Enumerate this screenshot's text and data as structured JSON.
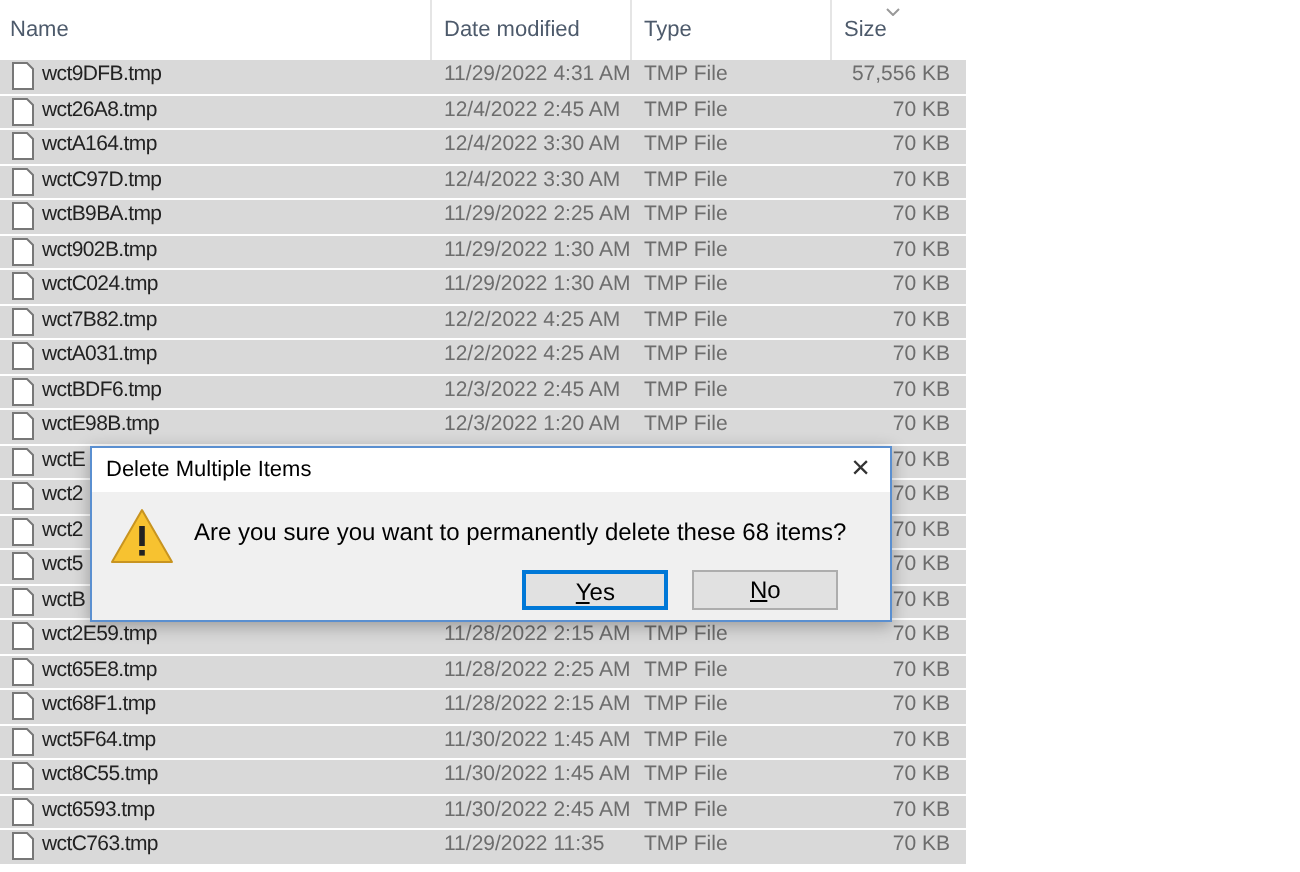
{
  "columns": [
    {
      "label": "Name"
    },
    {
      "label": "Date modified"
    },
    {
      "label": "Type"
    },
    {
      "label": "Size",
      "sorted": true
    }
  ],
  "rows": [
    {
      "name": "wct9DFB.tmp",
      "date": "11/29/2022 4:31 AM",
      "type": "TMP File",
      "size": "57,556 KB",
      "selected": true
    },
    {
      "name": "wct26A8.tmp",
      "date": "12/4/2022 2:45 AM",
      "type": "TMP File",
      "size": "70 KB",
      "selected": true
    },
    {
      "name": "wctA164.tmp",
      "date": "12/4/2022 3:30 AM",
      "type": "TMP File",
      "size": "70 KB",
      "selected": true
    },
    {
      "name": "wctC97D.tmp",
      "date": "12/4/2022 3:30 AM",
      "type": "TMP File",
      "size": "70 KB",
      "selected": true
    },
    {
      "name": "wctB9BA.tmp",
      "date": "11/29/2022 2:25 AM",
      "type": "TMP File",
      "size": "70 KB",
      "selected": true
    },
    {
      "name": "wct902B.tmp",
      "date": "11/29/2022 1:30 AM",
      "type": "TMP File",
      "size": "70 KB",
      "selected": true
    },
    {
      "name": "wctC024.tmp",
      "date": "11/29/2022 1:30 AM",
      "type": "TMP File",
      "size": "70 KB",
      "selected": true
    },
    {
      "name": "wct7B82.tmp",
      "date": "12/2/2022 4:25 AM",
      "type": "TMP File",
      "size": "70 KB",
      "selected": true
    },
    {
      "name": "wctA031.tmp",
      "date": "12/2/2022 4:25 AM",
      "type": "TMP File",
      "size": "70 KB",
      "selected": true
    },
    {
      "name": "wctBDF6.tmp",
      "date": "12/3/2022 2:45 AM",
      "type": "TMP File",
      "size": "70 KB",
      "selected": true
    },
    {
      "name": "wctE98B.tmp",
      "date": "12/3/2022 1:20 AM",
      "type": "TMP File",
      "size": "70 KB",
      "selected": true
    },
    {
      "name": "wctE",
      "size": "70 KB",
      "selected": true
    },
    {
      "name": "wct2",
      "size": "70 KB",
      "selected": true
    },
    {
      "name": "wct2",
      "size": "70 KB",
      "selected": true
    },
    {
      "name": "wct5",
      "size": "70 KB",
      "selected": true
    },
    {
      "name": "wctB",
      "size": "70 KB",
      "selected": true
    },
    {
      "name": "wct2E59.tmp",
      "date": "11/28/2022 2:15 AM",
      "type": "TMP File",
      "size": "70 KB",
      "selected": true
    },
    {
      "name": "wct65E8.tmp",
      "date": "11/28/2022 2:25 AM",
      "type": "TMP File",
      "size": "70 KB",
      "selected": true
    },
    {
      "name": "wct68F1.tmp",
      "date": "11/28/2022 2:15 AM",
      "type": "TMP File",
      "size": "70 KB",
      "selected": true
    },
    {
      "name": "wct5F64.tmp",
      "date": "11/30/2022 1:45 AM",
      "type": "TMP File",
      "size": "70 KB",
      "selected": true
    },
    {
      "name": "wct8C55.tmp",
      "date": "11/30/2022 1:45 AM",
      "type": "TMP File",
      "size": "70 KB",
      "selected": true
    },
    {
      "name": "wct6593.tmp",
      "date": "11/30/2022 2:45 AM",
      "type": "TMP File",
      "size": "70 KB",
      "selected": true
    },
    {
      "name": "wctC763.tmp",
      "date": "11/29/2022 11:35",
      "type": "TMP File",
      "size": "70 KB",
      "selected": true
    }
  ],
  "dialog": {
    "title": "Delete Multiple Items",
    "close": "×",
    "message": "Are you sure you want to permanently delete these 68 items?",
    "buttons": [
      {
        "label": "Yes",
        "focused": true
      },
      {
        "label": "No",
        "focused": false
      }
    ]
  }
}
